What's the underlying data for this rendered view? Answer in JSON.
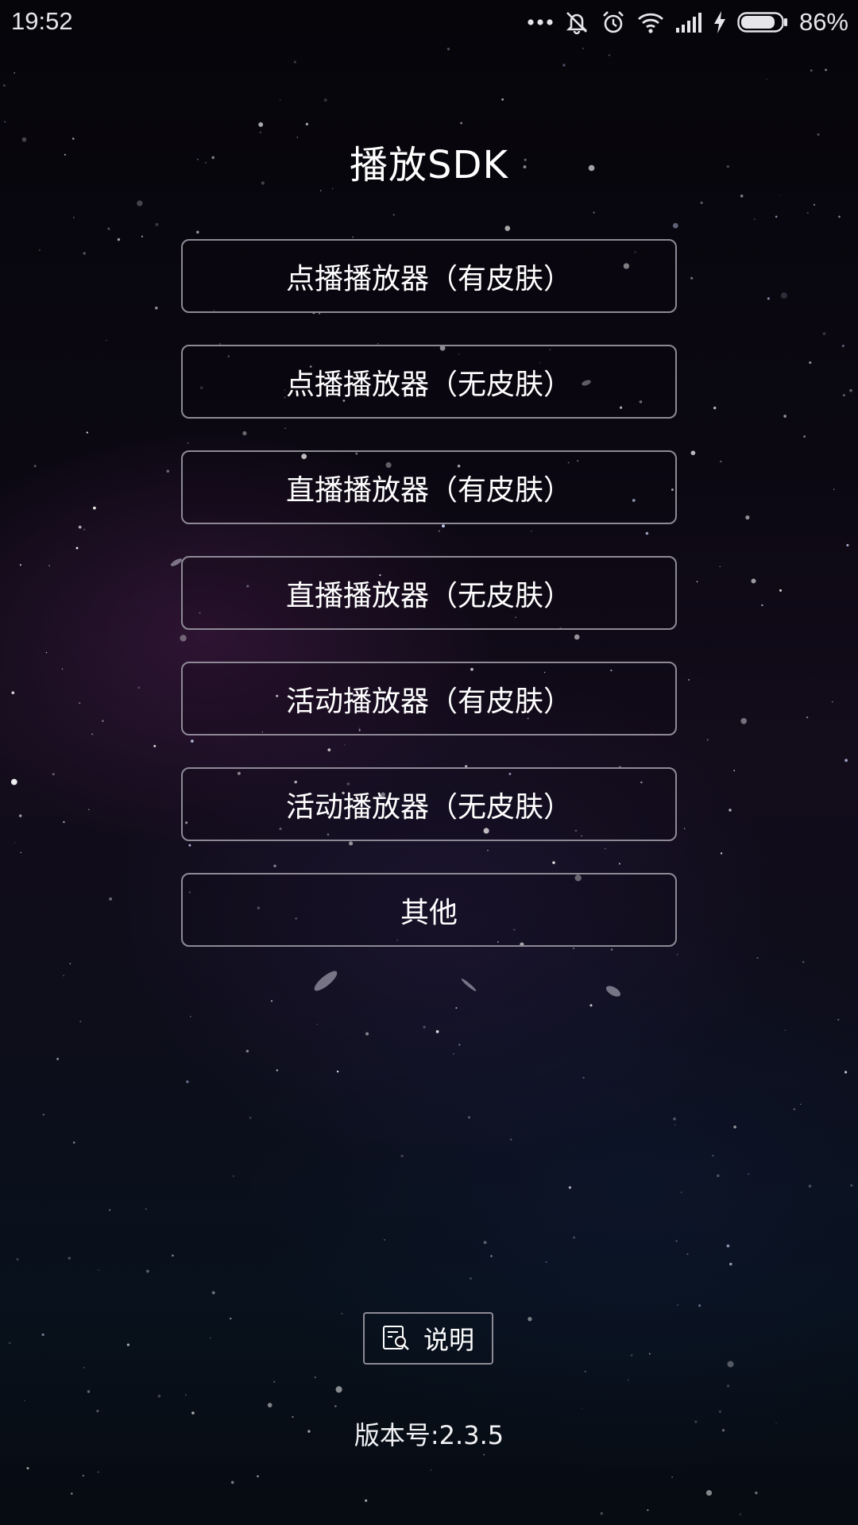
{
  "status_bar": {
    "time": "19:52",
    "icons": [
      "more-dots-icon",
      "silent-icon",
      "alarm-icon",
      "wifi-icon",
      "signal-icon",
      "charging-icon",
      "battery-icon"
    ],
    "battery_level": 0.86,
    "battery_text": "86%"
  },
  "title": "播放SDK",
  "menu": {
    "items": [
      {
        "label": "点播播放器（有皮肤）"
      },
      {
        "label": "点播播放器（无皮肤）"
      },
      {
        "label": "直播播放器（有皮肤）"
      },
      {
        "label": "直播播放器（无皮肤）"
      },
      {
        "label": "活动播放器（有皮肤）"
      },
      {
        "label": "活动播放器（无皮肤）"
      },
      {
        "label": "其他"
      }
    ]
  },
  "help": {
    "icon": "document-search-icon",
    "label": "说明"
  },
  "version": "版本号:2.3.5",
  "colors": {
    "button_border": "#8d8a96",
    "text": "#ffffff",
    "background": "#0b0812"
  }
}
